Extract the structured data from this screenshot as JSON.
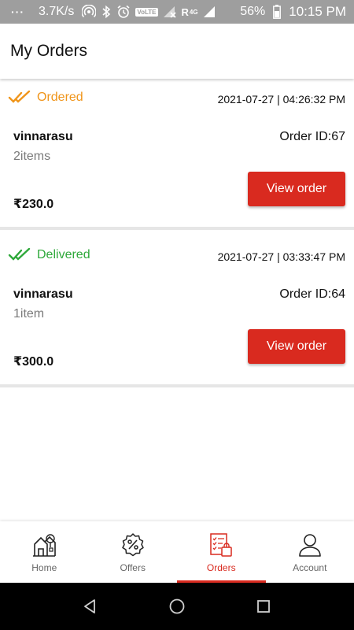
{
  "status_bar": {
    "dots": "···",
    "network_speed": "3.7K/s",
    "volte": "VoLTE",
    "roaming": "R",
    "signal_type": "4G",
    "battery": "56%",
    "time": "10:15 PM"
  },
  "header": {
    "title": "My Orders"
  },
  "orders": [
    {
      "status": "Ordered",
      "status_color": "#f0951a",
      "datetime": "2021-07-27 | 04:26:32 PM",
      "customer": "vinnarasu",
      "order_id": "Order ID:67",
      "items": "2items",
      "price": "₹230.0",
      "button_label": "View order"
    },
    {
      "status": "Delivered",
      "status_color": "#2ea83a",
      "datetime": "2021-07-27 | 03:33:47 PM",
      "customer": "vinnarasu",
      "order_id": "Order ID:64",
      "items": "1item",
      "price": "₹300.0",
      "button_label": "View order"
    }
  ],
  "bottom_nav": {
    "active": "Orders",
    "accent_color": "#d92a1f",
    "items": [
      {
        "label": "Home",
        "icon": "home-icon"
      },
      {
        "label": "Offers",
        "icon": "offers-icon"
      },
      {
        "label": "Orders",
        "icon": "orders-icon"
      },
      {
        "label": "Account",
        "icon": "account-icon"
      }
    ]
  }
}
